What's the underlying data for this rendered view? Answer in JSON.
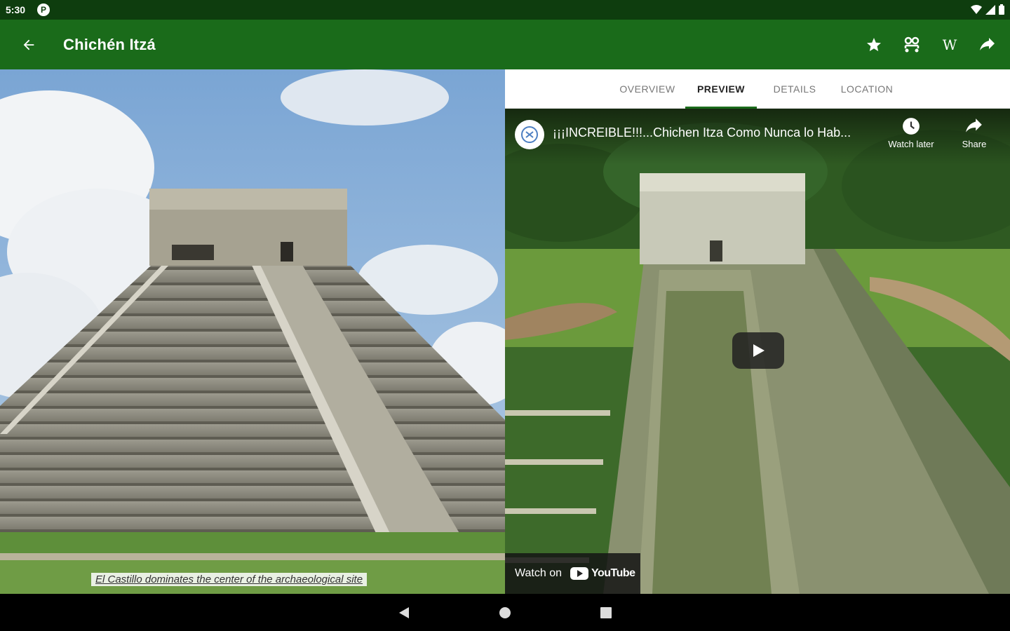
{
  "status_bar": {
    "time": "5:30",
    "app_icon_letter": "P"
  },
  "app_bar": {
    "title": "Chichén Itzá",
    "wiki_label": "W",
    "actions": [
      "star-icon",
      "compare-icon",
      "wikipedia-icon",
      "share-icon"
    ]
  },
  "photo": {
    "caption": "El Castillo dominates the center of the archaeological site"
  },
  "tabs": [
    {
      "label": "OVERVIEW",
      "active": false
    },
    {
      "label": "PREVIEW",
      "active": true
    },
    {
      "label": "DETAILS",
      "active": false
    },
    {
      "label": "LOCATION",
      "active": false
    }
  ],
  "video": {
    "title": "¡¡¡INCREIBLE!!!...Chichen Itza Como Nunca lo Hab...",
    "watch_later_label": "Watch later",
    "share_label": "Share",
    "watch_on_label": "Watch on",
    "youtube_label": "YouTube"
  },
  "colors": {
    "status_bar": "#0e3d0e",
    "app_bar": "#1a6b1a",
    "tab_indicator": "#1a6b1a"
  }
}
